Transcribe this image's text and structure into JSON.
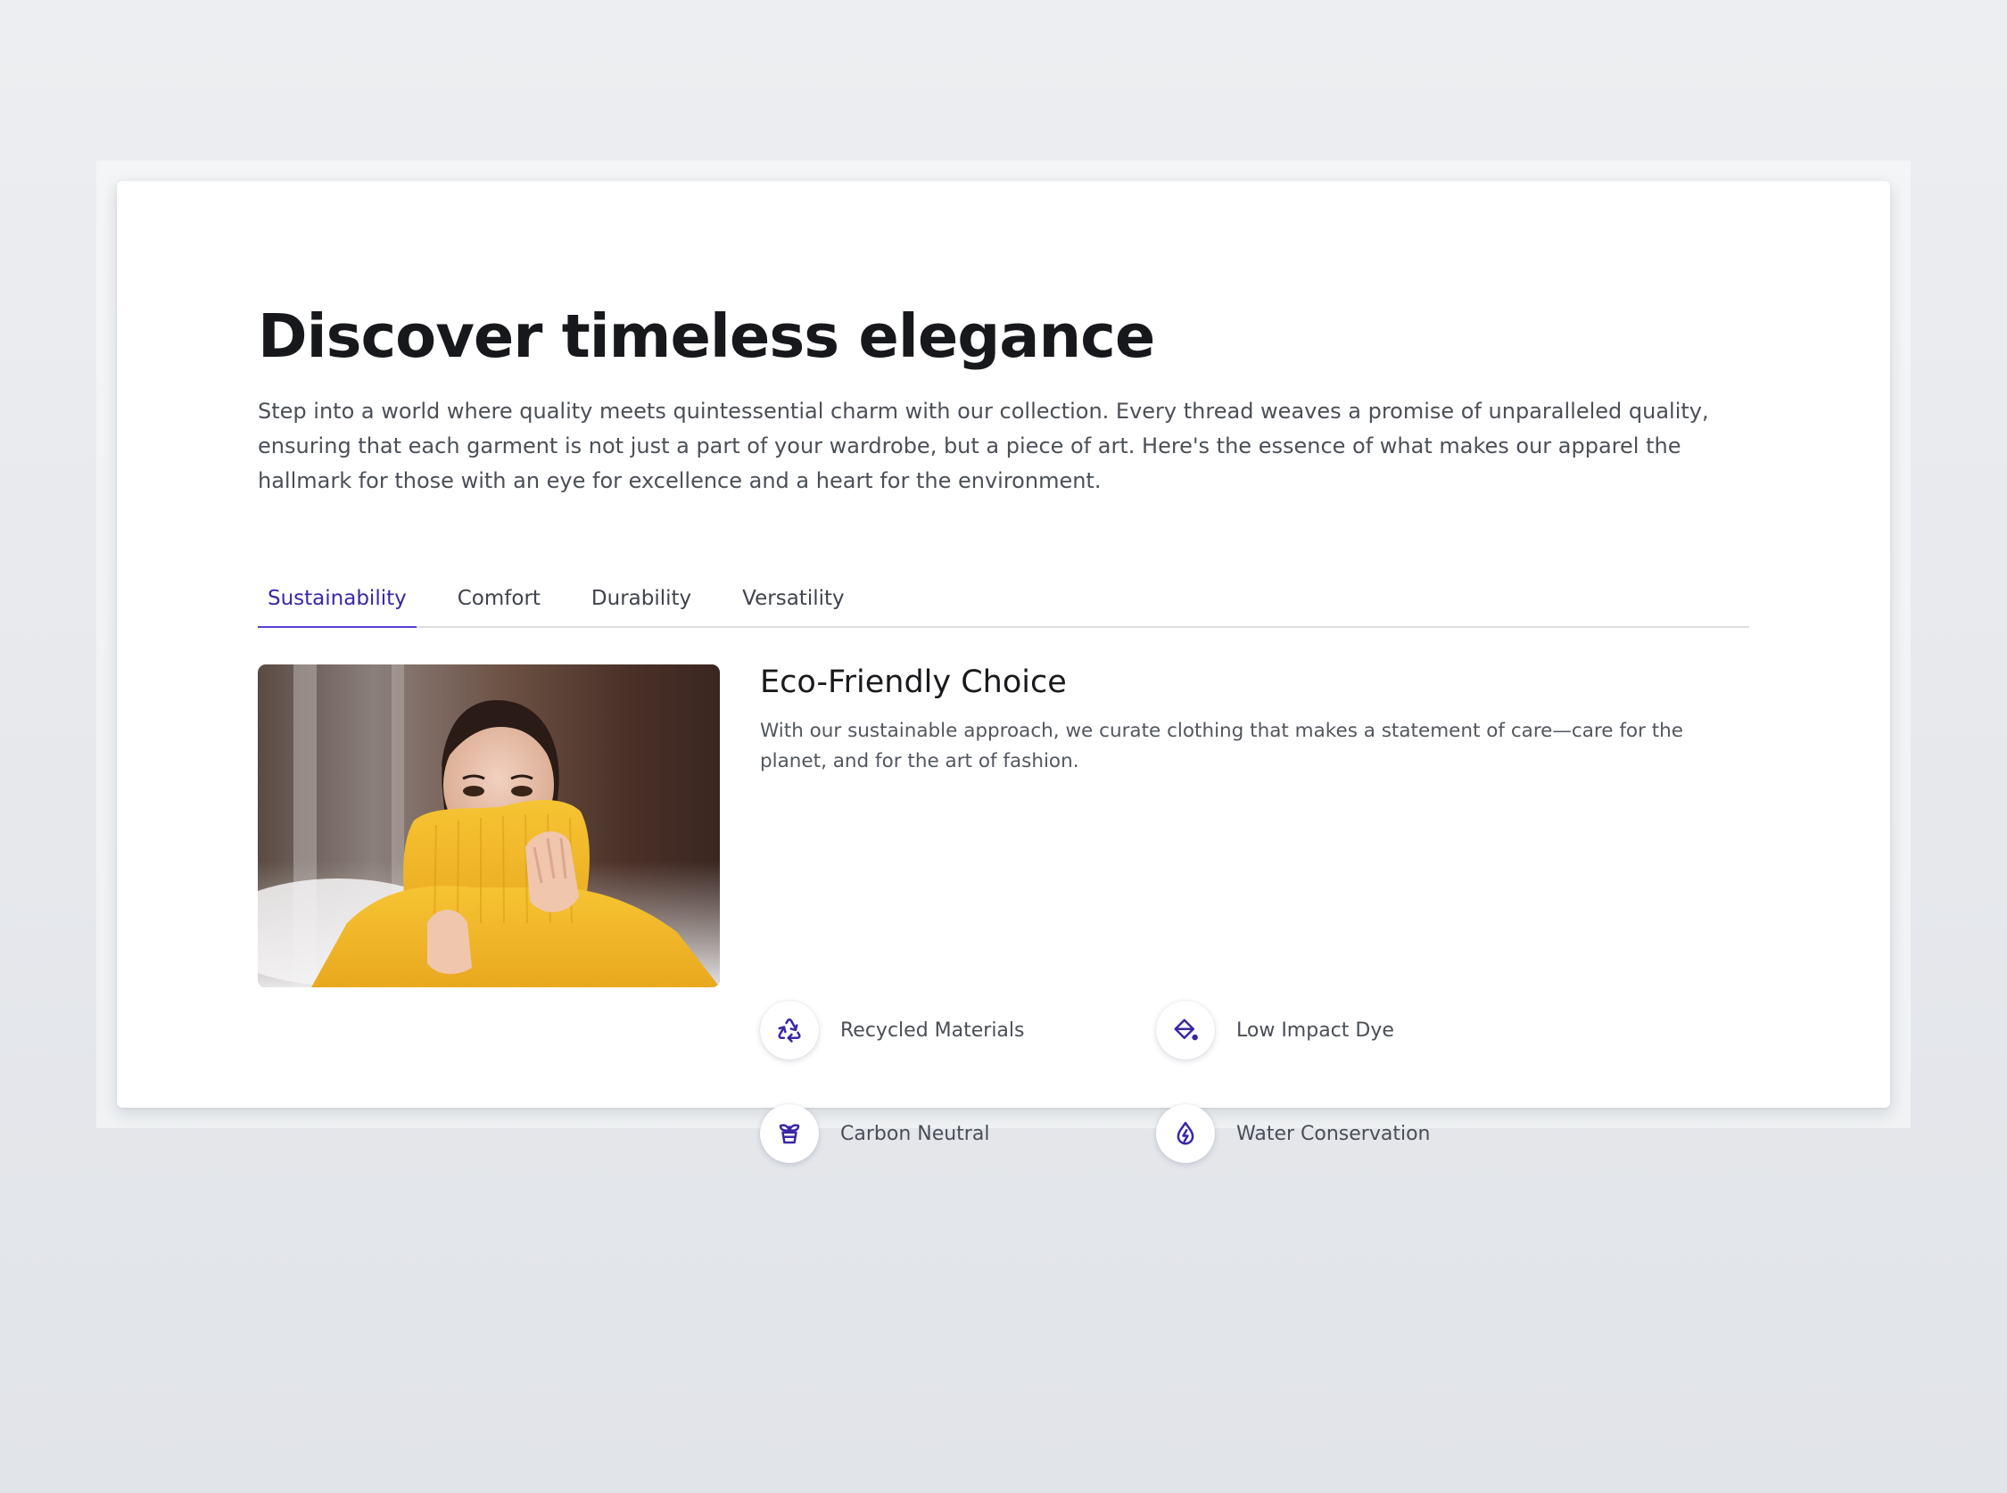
{
  "hero": {
    "title": "Discover timeless elegance",
    "intro": "Step into a world where quality meets quintessential charm with our collection. Every thread weaves a promise of unparalleled quality, ensuring that each garment is not just a part of your wardrobe, but a piece of art. Here's the essence of what makes our apparel the hallmark for those with an eye for excellence and a heart for the environment."
  },
  "tabs": [
    {
      "label": "Sustainability",
      "active": true
    },
    {
      "label": "Comfort",
      "active": false
    },
    {
      "label": "Durability",
      "active": false
    },
    {
      "label": "Versatility",
      "active": false
    }
  ],
  "panel": {
    "image": "woman-in-yellow-sweater-photo",
    "title": "Eco-Friendly Choice",
    "description": "With our sustainable approach, we curate clothing that makes a statement of care—care for the planet, and for the art of fashion.",
    "features": [
      {
        "label": "Recycled Materials",
        "icon": "recycle-icon"
      },
      {
        "label": "Low Impact Dye",
        "icon": "paint-bucket-icon"
      },
      {
        "label": "Carbon Neutral",
        "icon": "plant-pot-icon"
      },
      {
        "label": "Water Conservation",
        "icon": "water-drop-bolt-icon"
      }
    ]
  },
  "colors": {
    "accent": "#3b26a6",
    "tab_underline": "#5a3fd6",
    "title_text": "#17181b",
    "body_text": "#4b4f57",
    "page_background": "#e6e8ec",
    "card_background": "#ffffff"
  }
}
